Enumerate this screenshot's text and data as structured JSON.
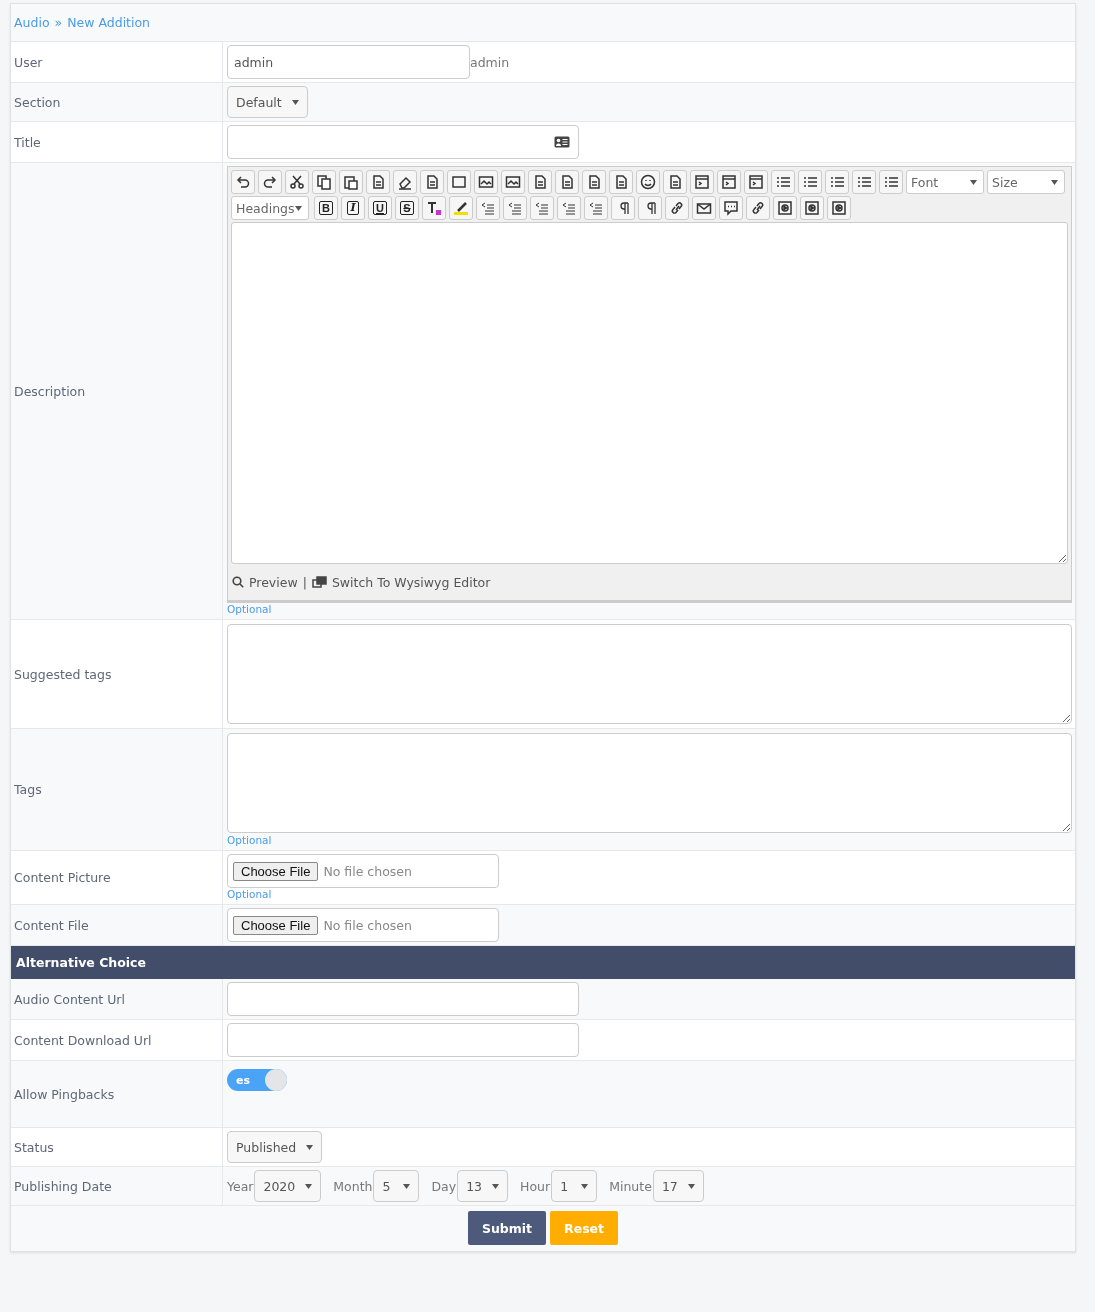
{
  "breadcrumb": {
    "items": [
      "Audio",
      "New Addition"
    ],
    "separator": "»"
  },
  "rows": [
    {
      "kind": "text_input",
      "label": "User",
      "value": "admin",
      "suffix": "admin"
    },
    {
      "kind": "select",
      "label": "Section",
      "value": "Default"
    },
    {
      "kind": "title_input",
      "label": "Title"
    },
    {
      "kind": "editor",
      "label": "Description",
      "font": "Font",
      "size": "Size",
      "headings": "Headings",
      "format_buttons": [
        "B",
        "I",
        "U",
        "S"
      ],
      "preview": "Preview",
      "separator": "|",
      "switch": "Switch To Wysiwyg Editor",
      "hint": "Optional"
    },
    {
      "kind": "textarea",
      "label": "Suggested tags"
    },
    {
      "kind": "textarea",
      "label": "Tags",
      "hint": "Optional"
    },
    {
      "kind": "file",
      "label": "Content Picture",
      "button": "Choose File",
      "status": "No file chosen",
      "hint": "Optional"
    },
    {
      "kind": "file",
      "label": "Content File",
      "button": "Choose File",
      "status": "No file chosen"
    },
    {
      "kind": "section",
      "label": "Alternative Choice"
    },
    {
      "kind": "input",
      "label": "Audio Content Url"
    },
    {
      "kind": "input",
      "label": "Content Download Url"
    },
    {
      "kind": "toggle",
      "label": "Allow Pingbacks",
      "text": "es",
      "on": true
    },
    {
      "kind": "select",
      "label": "Status",
      "value": "Published"
    },
    {
      "kind": "date",
      "label": "Publishing Date",
      "parts": [
        {
          "label": "Year",
          "value": "2020"
        },
        {
          "label": "Month",
          "value": "5"
        },
        {
          "label": "Day",
          "value": "13"
        },
        {
          "label": "Hour",
          "value": "1"
        },
        {
          "label": "Minute",
          "value": "17"
        }
      ]
    }
  ],
  "actions": [
    {
      "label": "Submit",
      "kind": "primary"
    },
    {
      "label": "Reset",
      "kind": "warning"
    }
  ]
}
